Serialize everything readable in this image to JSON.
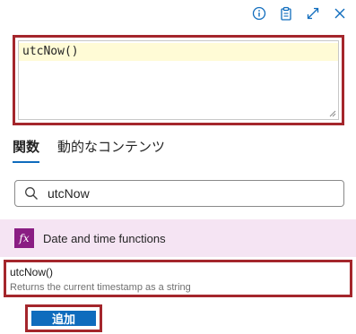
{
  "toolbar": {
    "icons": [
      "info-icon",
      "clipboard-icon",
      "expand-icon",
      "close-icon"
    ],
    "accent": "#0f6cbd"
  },
  "editor": {
    "value": "utcNow()"
  },
  "tabs": [
    {
      "label": "関数",
      "active": true
    },
    {
      "label": "動的なコンテンツ",
      "active": false
    }
  ],
  "search": {
    "value": "utcNow",
    "placeholder": ""
  },
  "category": {
    "label": "Date and time functions",
    "icon": "fx",
    "icon_color": "#8a1d83"
  },
  "function": {
    "name": "utcNow()",
    "description": "Returns the current timestamp as a string"
  },
  "add_button": {
    "label": "追加"
  },
  "colors": {
    "highlight_border": "#a4262c",
    "category_bg": "#f5e4f3",
    "button_bg": "#0f6cbd"
  }
}
